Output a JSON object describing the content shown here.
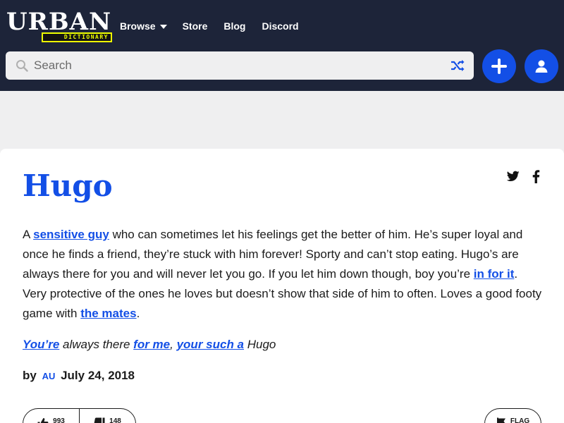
{
  "app": {
    "logo_text": "URBAN",
    "logo_subtext": "DICTIONARY"
  },
  "nav": {
    "items": [
      {
        "label": "Browse",
        "has_dropdown": true
      },
      {
        "label": "Store"
      },
      {
        "label": "Blog"
      },
      {
        "label": "Discord"
      }
    ]
  },
  "search": {
    "placeholder": "Search",
    "value": ""
  },
  "colors": {
    "header_bg": "#1d2439",
    "accent_blue": "#134fe6",
    "logo_yellow": "#efff00",
    "page_bg": "#efeff0"
  },
  "icons": {
    "search": "search-icon",
    "random": "shuffle-icon",
    "add": "plus-icon",
    "account": "user-icon",
    "twitter": "twitter-icon",
    "facebook": "facebook-icon",
    "upvote": "thumbs-up-icon",
    "downvote": "thumbs-down-icon",
    "flag": "flag-icon"
  },
  "definition": {
    "word": "Hugo",
    "meaning": {
      "t1": "A ",
      "link1": "sensitive guy",
      "t2": " who can sometimes let his feelings get the better of him. He’s super loyal and once he finds a friend, they’re stuck with him forever! Sporty and can’t stop eating. Hugo’s are always there for you and will never let you go. If you let him down though, boy you’re ",
      "link2": "in for it",
      "t3": ". Very protective of the ones he loves but doesn’t show that side of him to often. Loves a good footy game with ",
      "link3": "the mates",
      "t4": "."
    },
    "example": {
      "link1": "You’re",
      "t1": " always there ",
      "link2": "for me",
      "t2": ", ",
      "link3": "your such a",
      "t3": " Hugo"
    },
    "contributor": {
      "by_label": "by",
      "author": "AU",
      "date": "July 24, 2018"
    },
    "votes": {
      "up": "993",
      "down": "148"
    },
    "flag_label": "FLAG"
  }
}
